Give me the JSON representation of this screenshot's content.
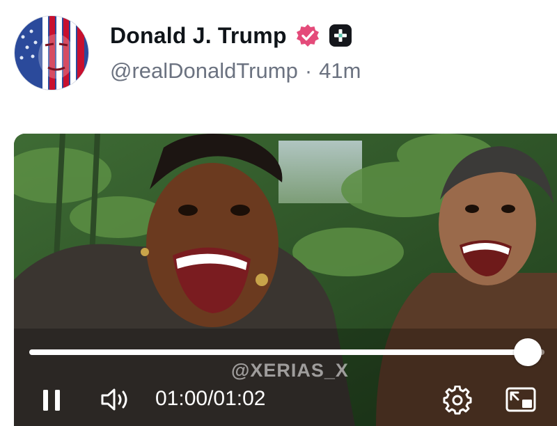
{
  "post": {
    "display_name": "Donald J. Trump",
    "handle": "@realDonaldTrump",
    "separator": "·",
    "time_ago": "41m",
    "verified_color": "#e44b7a",
    "plus_badge_color": "#15171c"
  },
  "video": {
    "watermark": "@XERIAS_X",
    "current_time": "01:00",
    "time_divider": "/",
    "duration": "01:02",
    "progress_fraction": 0.968,
    "playing": true
  }
}
